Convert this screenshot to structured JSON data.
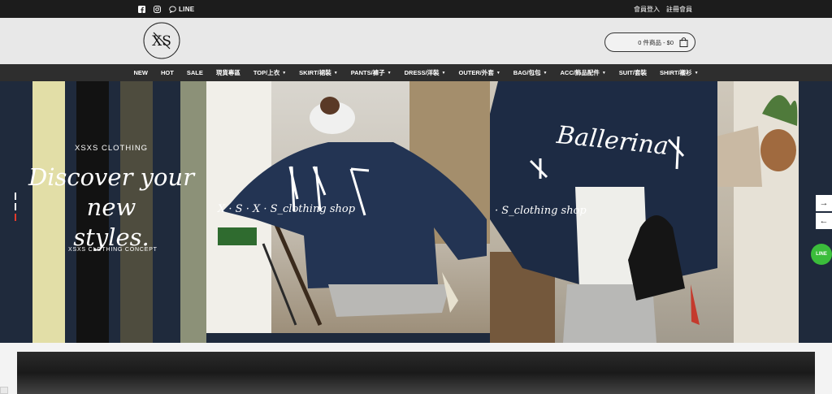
{
  "topbar": {
    "social": [
      "facebook-icon",
      "instagram-icon"
    ],
    "line_label": "LINE",
    "login": "會員登入",
    "register": "註冊會員"
  },
  "header": {
    "logo_text": "XS",
    "cart_label": "0 件商品 - $0"
  },
  "nav": {
    "items": [
      {
        "label": "NEW",
        "dropdown": false
      },
      {
        "label": "HOT",
        "dropdown": false
      },
      {
        "label": "SALE",
        "dropdown": false
      },
      {
        "label": "現貨專區",
        "dropdown": false
      },
      {
        "label": "TOP/上衣",
        "dropdown": true
      },
      {
        "label": "SKIRT/裙裝",
        "dropdown": true
      },
      {
        "label": "PANTS/褲子",
        "dropdown": true
      },
      {
        "label": "DRESS/洋裝",
        "dropdown": true
      },
      {
        "label": "OUTER/外套",
        "dropdown": true
      },
      {
        "label": "BAG/包包",
        "dropdown": true
      },
      {
        "label": "ACC/飾品配件",
        "dropdown": true
      },
      {
        "label": "SUIT/套裝",
        "dropdown": false
      },
      {
        "label": "SHIRT/襯衫",
        "dropdown": true
      }
    ]
  },
  "hero": {
    "brand": "XSXS CLOTHING",
    "headline_1": "Discover your new",
    "headline_2": "styles.",
    "concept": "XSXS CLOTHING CONCEPT",
    "watermark_1": "X · S · X · S_clothing shop",
    "watermark_2": "· S_clothing shop",
    "jacket_text": "Ballerina",
    "next_icon": "→",
    "prev_icon": "←"
  },
  "float": {
    "line_label": "LINE"
  },
  "colors": {
    "topbar": "#1c1c1c",
    "nav": "#2e2e2e",
    "hero_bg": "#1f2a3c",
    "slider_active": "#e53b2c",
    "line_green": "#3bbd3b"
  }
}
